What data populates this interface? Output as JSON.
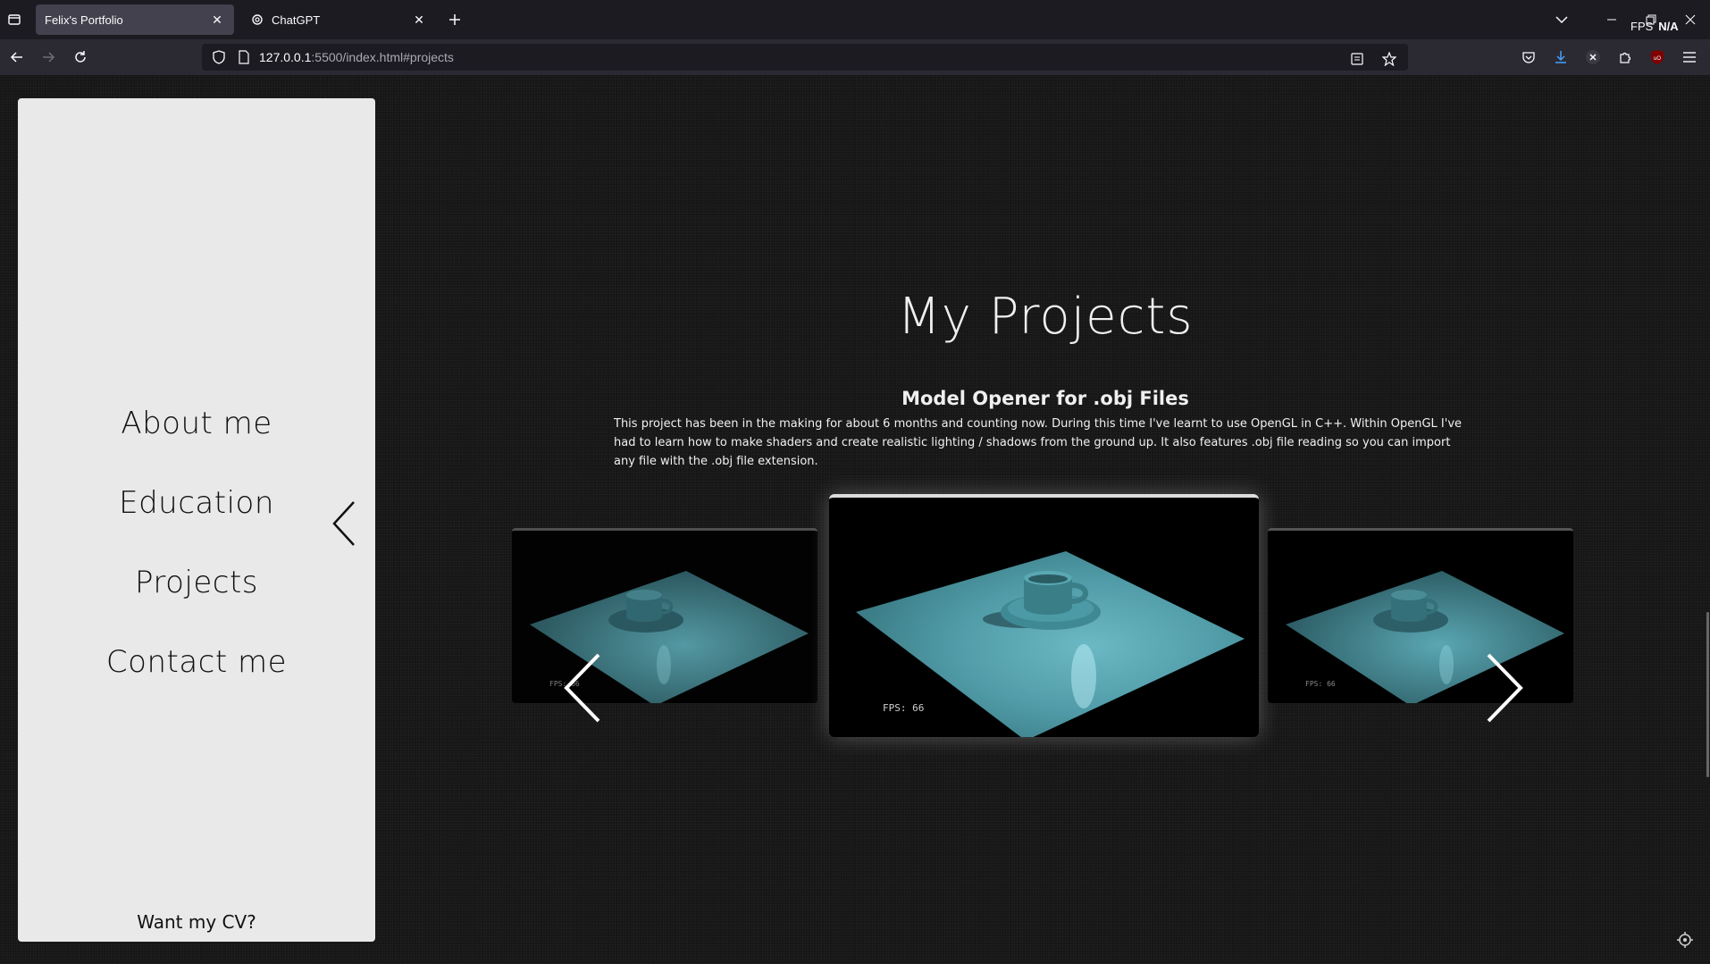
{
  "browser": {
    "tabs": [
      {
        "label": "Felix's Portfolio",
        "active": true
      },
      {
        "label": "ChatGPT",
        "active": false
      }
    ],
    "url_host": "127.0.0.1",
    "url_rest": ":5500/index.html#projects",
    "fps_label": "FPS",
    "fps_value": "N/A"
  },
  "sidebar": {
    "items": [
      {
        "label": "About me"
      },
      {
        "label": "Education"
      },
      {
        "label": "Projects"
      },
      {
        "label": "Contact me"
      }
    ],
    "cv_link": "Want my CV?"
  },
  "main": {
    "title": "My Projects",
    "project": {
      "title": "Model Opener for .obj Files",
      "description": "This project has been in the making for about 6 months and counting now. During this time I've learnt to use OpenGL in C++. Within OpenGL I've had to learn how to make shaders and create realistic lighting / shadows from the ground up. It also features .obj file reading so you can import any file with the .obj file extension."
    },
    "carousel": {
      "slides": [
        {
          "fps_text": "FPS: 66"
        },
        {
          "fps_text": "FPS: 66"
        },
        {
          "fps_text": "FPS: 66"
        }
      ]
    }
  },
  "colors": {
    "accent_download": "#45a1ff",
    "scene_plane": "#4f9aa6",
    "ublock": "#800000"
  }
}
